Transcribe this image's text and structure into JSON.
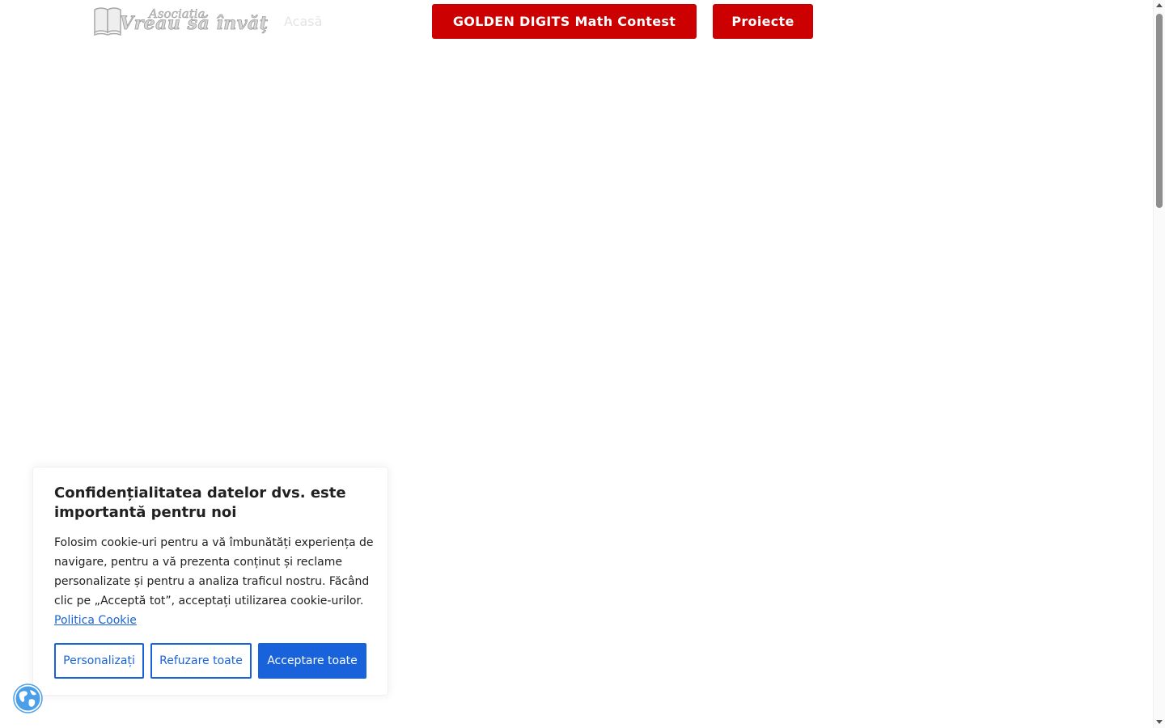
{
  "header": {
    "logo": {
      "line1": "Asociația",
      "line2": "Vreau să învăț"
    },
    "nav_home": "Acasă",
    "contest_button": "GOLDEN DIGITS Math Contest",
    "projects_button": "Proiecte"
  },
  "cookie_banner": {
    "title": "Confidențialitatea datelor dvs. este importantă pentru noi",
    "body": "Folosim cookie-uri pentru a vă îmbunătăți experiența de navigare, pentru a vă prezenta conținut și reclame personalizate și pentru a analiza traficul nostru. Făcând clic pe „Acceptă tot”, acceptați utilizarea cookie-urilor.",
    "policy_link": "Politica Cookie",
    "customize_button": "Personalizați",
    "reject_button": "Refuzare toate",
    "accept_button": "Acceptare toate"
  },
  "revisit_icon": "globe-icon",
  "colors": {
    "brand_red": "#cc0000",
    "consent_blue": "#1863dc",
    "text_dark": "#212121",
    "globe_blue": "#4a9fe8"
  }
}
